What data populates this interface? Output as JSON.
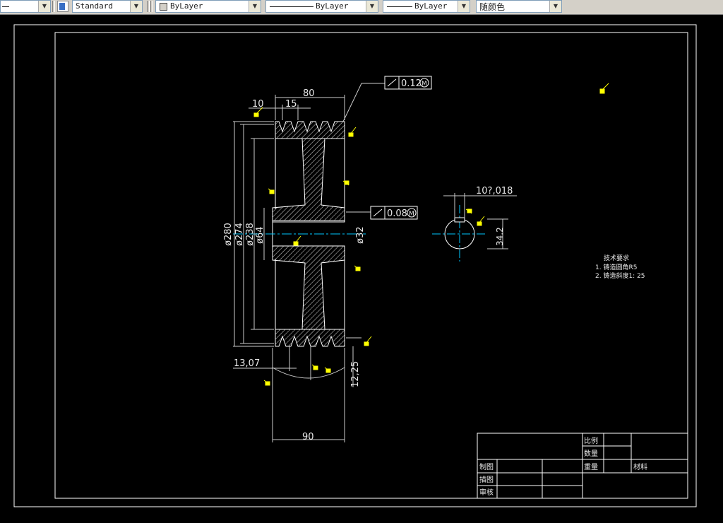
{
  "toolbar": {
    "textstyle_value": "Standard",
    "layer_value": "ByLayer",
    "linetype_value": "ByLayer",
    "lineweight_value": "ByLayer",
    "color_value": "随颜色"
  },
  "drawing": {
    "dims": {
      "d80": "80",
      "d10": "10",
      "d15": "15",
      "d280": "ø280",
      "d274": "ø274",
      "d238": "ø238",
      "d64": "ø64",
      "d32": "ø32",
      "d90": "90",
      "d13_07": "13,07",
      "d12_25": "12,25",
      "d10_018": "10?,018",
      "d34": "34.2"
    },
    "tolerances": {
      "top_value": "0.12",
      "mid_value": "0.08",
      "modifier": "M"
    },
    "notes": {
      "heading": "技术要求",
      "line1": "1. 铸造圆角R5",
      "line2": "2. 铸造斜度1: 25"
    },
    "title_block": {
      "scale": "比例",
      "quantity": "数量",
      "weight": "重量",
      "material": "材料",
      "drawn": "制图",
      "traced": "描图",
      "checked": "审核"
    }
  },
  "colors": {
    "background": "#000000",
    "lines": "#ffffff",
    "center_lines": "#00c8ff",
    "roughness_marks": "#ffff00"
  }
}
